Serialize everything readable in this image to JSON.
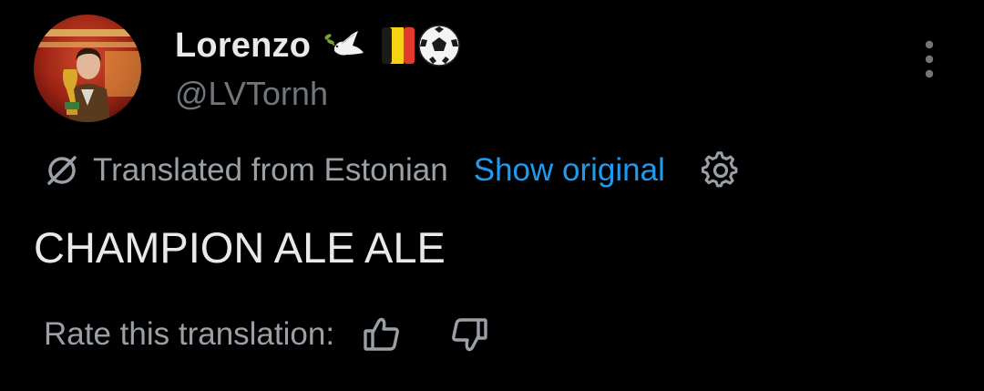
{
  "post": {
    "author": {
      "display_name": "Lorenzo",
      "handle": "@LVTornh",
      "name_emojis": [
        "dove-with-olive-branch",
        "belgium-flag",
        "soccer-ball"
      ],
      "avatar": "profile photo holding world cup trophy"
    },
    "translation_bar": {
      "translated_from": "Translated from Estonian",
      "show_original": "Show original",
      "link_color": "#1d9bf0"
    },
    "text": "CHAMPION ALE ALE",
    "rating": {
      "label": "Rate this translation:",
      "thumbs_up_icon": "thumbs-up-icon",
      "thumbs_down_icon": "thumbs-down-icon"
    },
    "menu_icon": "more-vertical-icon"
  },
  "colors": {
    "background": "#000000",
    "primary_text": "#e7e9ea",
    "secondary_text": "#71767b",
    "accent": "#1d9bf0"
  }
}
